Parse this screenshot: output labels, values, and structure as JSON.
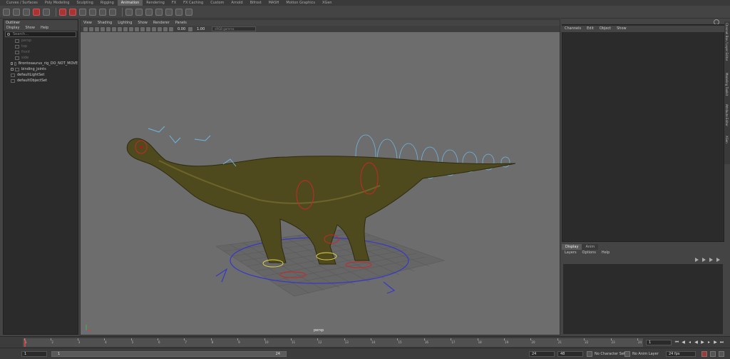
{
  "shelf_tabs": [
    "Curves / Surfaces",
    "Poly Modeling",
    "Sculpting",
    "Rigging",
    "Animation",
    "Rendering",
    "FX",
    "FX Caching",
    "Custom",
    "Arnold",
    "Bifrost",
    "MASH",
    "Motion Graphics",
    "XGen"
  ],
  "active_shelf_tab": "Animation",
  "outliner": {
    "title": "Outliner",
    "menu": [
      "Display",
      "Show",
      "Help"
    ],
    "search_placeholder": "Search...",
    "items": [
      {
        "label": "persp",
        "dim": true
      },
      {
        "label": "top",
        "dim": true
      },
      {
        "label": "front",
        "dim": true
      },
      {
        "label": "side",
        "dim": true
      },
      {
        "label": "Brontosaurus_rig_DO_NOT_MOVE",
        "dim": false
      },
      {
        "label": "binding_joints",
        "dim": false
      },
      {
        "label": "defaultLightSet",
        "dim": false
      },
      {
        "label": "defaultObjectSet",
        "dim": false
      }
    ]
  },
  "viewport": {
    "menu": [
      "View",
      "Shading",
      "Lighting",
      "Show",
      "Renderer",
      "Panels"
    ],
    "value_a": "0.00",
    "value_b": "1.00",
    "color_space": "sRGB gamma",
    "camera_label": "persp"
  },
  "channel_box": {
    "menu": [
      "Channels",
      "Edit",
      "Object",
      "Show"
    ]
  },
  "side_tabs": [
    "Channel Box / Layer Editor",
    "Modeling Toolkit",
    "Attribute Editor",
    "XGen"
  ],
  "layer_editor": {
    "tabs": [
      "Display",
      "Anim"
    ],
    "active_tab": "Display",
    "menu": [
      "Layers",
      "Options",
      "Help"
    ]
  },
  "timeline": {
    "ticks": [
      "1",
      "2",
      "3",
      "4",
      "5",
      "6",
      "7",
      "8",
      "9",
      "10",
      "11",
      "12",
      "13",
      "14",
      "15",
      "16",
      "17",
      "18",
      "19",
      "20",
      "21",
      "22",
      "23",
      "24"
    ],
    "current_frame": "1"
  },
  "range": {
    "start": "1",
    "slider_start": "1",
    "slider_end": "24",
    "end": "24",
    "anim_end": "48",
    "character_set": "No Character Set",
    "anim_layer": "No Anim Layer",
    "fps": "24 fps"
  }
}
